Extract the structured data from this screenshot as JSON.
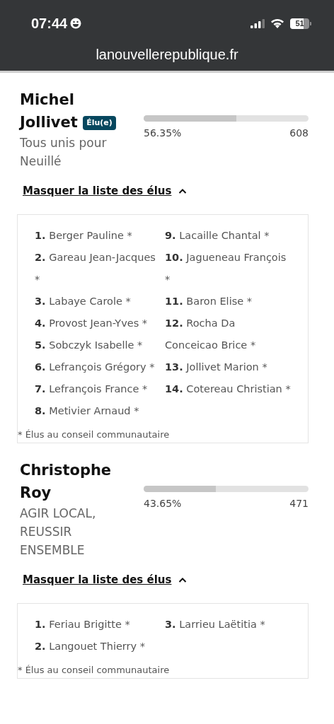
{
  "status_bar": {
    "time": "07:44",
    "battery": "51"
  },
  "address_bar": {
    "url": "lanouvellerepublique.fr"
  },
  "candidates": [
    {
      "name": "Michel Jollivet",
      "badge": "Élu(e)",
      "party": "Tous unis pour Neuillé",
      "level": 0.5635,
      "percent": "56.35%",
      "votes": "608",
      "toggle": "Masquer la liste des élus",
      "expanded": true,
      "columns": [
        [
          {
            "number": "1.",
            "name": "Berger Pauline *"
          },
          {
            "number": "2.",
            "name": "Gareau Jean-Jacques *"
          },
          {
            "number": "3.",
            "name": "Labaye Carole *"
          },
          {
            "number": "4.",
            "name": "Provost Jean-Yves *"
          },
          {
            "number": "5.",
            "name": "Sobczyk Isabelle *"
          },
          {
            "number": "6.",
            "name": "Lefrançois Grégory *"
          },
          {
            "number": "7.",
            "name": "Lefrançois France *"
          },
          {
            "number": "8.",
            "name": "Metivier Arnaud *"
          }
        ],
        [
          {
            "number": "9.",
            "name": "Lacaille Chantal *"
          },
          {
            "number": "10.",
            "name": "Jagueneau François *"
          },
          {
            "number": "11.",
            "name": "Baron Elise *"
          },
          {
            "number": "12.",
            "name": "Rocha Da Conceicao Brice *"
          },
          {
            "number": "13.",
            "name": "Jollivet Marion *"
          },
          {
            "number": "14.",
            "name": "Cotereau Christian *"
          }
        ]
      ],
      "footnote": "* Élus au conseil communautaire"
    },
    {
      "name": "Christophe Roy",
      "party": "AGIR LOCAL, REUSSIR ENSEMBLE",
      "level": 0.4365,
      "percent": "43.65%",
      "votes": "471",
      "toggle": "Masquer la liste des élus",
      "expanded": true,
      "columns": [
        [
          {
            "number": "1.",
            "name": "Feriau Brigitte *"
          },
          {
            "number": "2.",
            "name": "Langouet Thierry *"
          }
        ],
        [
          {
            "number": "3.",
            "name": "Larrieu Laëtitia *"
          }
        ]
      ],
      "footnote": "* Élus au conseil communautaire"
    }
  ]
}
